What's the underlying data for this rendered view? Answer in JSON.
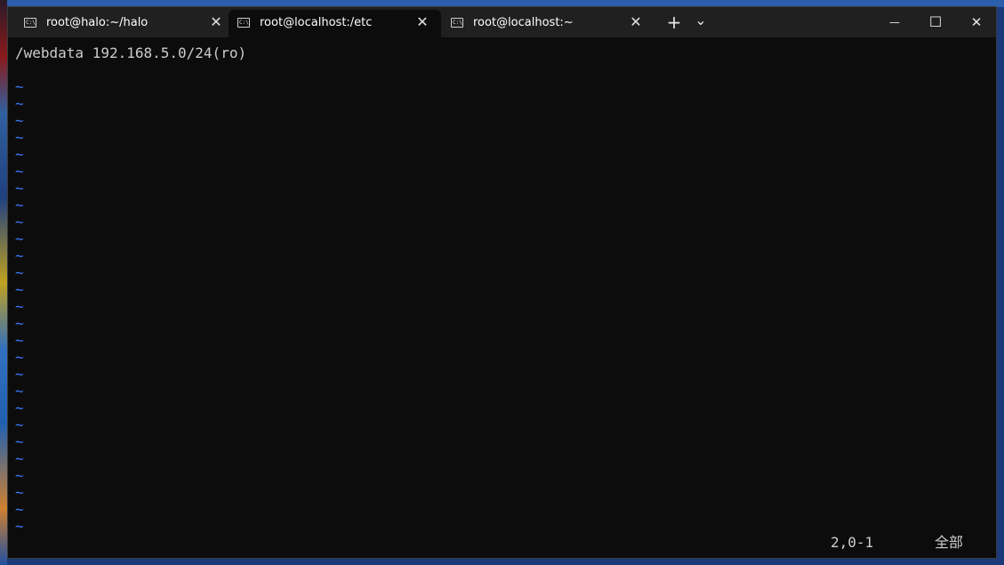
{
  "tabs": [
    {
      "label": "root@halo:~/halo",
      "icon": "terminal-icon",
      "active": false
    },
    {
      "label": "root@localhost:/etc",
      "icon": "terminal-icon",
      "active": true
    },
    {
      "label": "root@localhost:~",
      "icon": "terminal-icon",
      "active": false
    }
  ],
  "tab_icon_text": "C:\\",
  "tab_close_glyph": "✕",
  "new_tab_glyph": "+",
  "dropdown_glyph": "⌄",
  "window_controls": {
    "minimize": "—",
    "maximize": "☐",
    "close": "✕"
  },
  "editor": {
    "content_line": "/webdata 192.168.5.0/24(ro)",
    "empty_line_marker": "~",
    "empty_line_count": 27,
    "cursor_position": "2,0-1",
    "scroll_position": "全部"
  },
  "colors": {
    "background": "#0c0c0c",
    "tilde": "#3b78ff",
    "text": "#cccccc"
  }
}
